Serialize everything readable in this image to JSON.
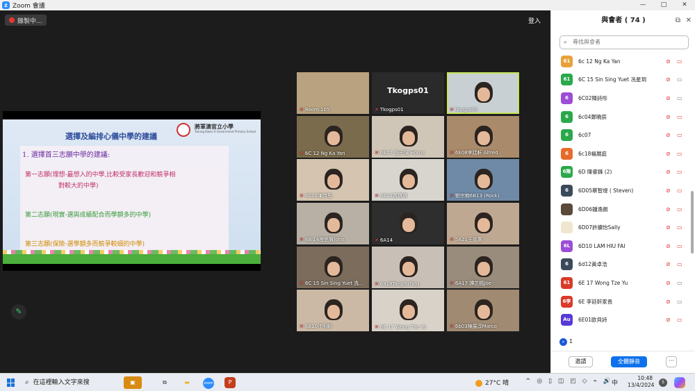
{
  "window": {
    "title": "Zoom 會議",
    "controls": [
      "—",
      "□",
      "✕"
    ]
  },
  "meeting": {
    "recording_label": "錄製中...",
    "exit_label": "登入"
  },
  "slide": {
    "title": "選擇及編排心儀中學的建議",
    "school_name": "將軍澳官立小學",
    "school_name_en": "Tseung Kwan O Government Primary School",
    "heading": "1. 選擇首三志願中學的建議:",
    "choice1_line1": "第一志願(理想-最想入的中學,比較受家長歡迎和競爭相",
    "choice1_line2": "對較大的中學)",
    "choice2": "第二志願(現實-選與成績配合而學額多的中學)",
    "choice3": "第三志願(保險-選學額多而競爭較細的中學)"
  },
  "videos": [
    {
      "label": "Room 105",
      "bg": "#b9a27f"
    },
    {
      "label": "Tkogps01",
      "bg": "#2a2a2a",
      "bigname": "Tkogps01"
    },
    {
      "label": "tkogps09",
      "bg": "#c9d0d3"
    },
    {
      "label": "6C 12 Ng Ka Yan",
      "bg": "#7a6b4c"
    },
    {
      "label": "6B17 洗子誠 Horus",
      "bg": "#cfc6b8"
    },
    {
      "label": "6E08李廷軒 Alfred",
      "bg": "#a98a6a"
    },
    {
      "label": "6C02陳詩彤",
      "bg": "#d4c4b0"
    },
    {
      "label": "6B22黃琪琪",
      "bg": "#d8d5cf"
    },
    {
      "label": "劉宗楠6B13 (Rock)",
      "bg": "#6f8aa6"
    },
    {
      "label": "6B 14陸思賢John",
      "bg": "#b8b0a4"
    },
    {
      "label": "6A14",
      "bg": "#2e2e2e"
    },
    {
      "label": "5A21王盐蕙",
      "bg": "#bfa892"
    },
    {
      "label": "6C 15 Sin Sing Yuet 洗...",
      "bg": "#7c6c5c"
    },
    {
      "label": "6a18TangYuTing",
      "bg": "#c8c0b6"
    },
    {
      "label": "6A17 譚芷楓Joe",
      "bg": "#9a8c7c"
    },
    {
      "label": "6B10江明軒",
      "bg": "#cbb9a6"
    },
    {
      "label": "6E 17 Wong Tze Yu",
      "bg": "#d9d2c8"
    },
    {
      "label": "6b03陳展淳Marco",
      "bg": "#a08a72"
    }
  ],
  "participants_panel": {
    "title": "與會者 ( 74 )",
    "popout_icon": "⧉",
    "close_icon": "✕",
    "search_placeholder": "尋找與會者",
    "raised_hands_label": "1",
    "raised_hands_icon": "»",
    "invite_label": "邀請",
    "mute_all_label": "全體靜音",
    "more_label": "···",
    "items": [
      {
        "avatar": "61",
        "color": "#e8a23a",
        "name": "6c 12 Ng Ka Yan",
        "cam": "off"
      },
      {
        "avatar": "61",
        "color": "#2aa84a",
        "name": "6C 15 Sin Sing Yuet 冼星玥",
        "cam": "on"
      },
      {
        "avatar": "6",
        "color": "#9b4dd6",
        "name": "6C02陳詩彤",
        "cam": "on"
      },
      {
        "avatar": "6",
        "color": "#2aa84a",
        "name": "6c04鄭曉辰",
        "cam": "off"
      },
      {
        "avatar": "6",
        "color": "#2aa84a",
        "name": "6c07",
        "cam": "off"
      },
      {
        "avatar": "6",
        "color": "#e86a2a",
        "name": "6c18楊展庭",
        "cam": "off"
      },
      {
        "avatar": "6陳",
        "color": "#2aa84a",
        "name": "6D 陳睿鋒 (2)",
        "cam": "off"
      },
      {
        "avatar": "6",
        "color": "#3a4a5a",
        "name": "6D05蔡智燈 ( Steven)",
        "cam": "off"
      },
      {
        "avatar": "",
        "color": "#5a4a3a",
        "name": "6D06鍾逸朗",
        "cam": "off"
      },
      {
        "avatar": "",
        "color": "#f0e6d0",
        "name": "6D07許擴怡Sally",
        "cam": "off"
      },
      {
        "avatar": "6L",
        "color": "#9b4dd6",
        "name": "6D10 LAM HIU FAI",
        "cam": "off"
      },
      {
        "avatar": "6",
        "color": "#3a4a5a",
        "name": "6d12黃卓浩",
        "cam": "off"
      },
      {
        "avatar": "61",
        "color": "#d93a2a",
        "name": "6E 17 Wong Tze Yu",
        "cam": "on"
      },
      {
        "avatar": "6李",
        "color": "#d93a2a",
        "name": "6E 李廷軒家長",
        "cam": "on"
      },
      {
        "avatar": "Au",
        "color": "#5a3ad6",
        "name": "6E01歐貝詩",
        "cam": "off"
      }
    ]
  },
  "taskbar": {
    "search_placeholder": "在這裡輸入文字來搜",
    "zoom_label": "zoom",
    "ppt_label": "P",
    "weather_temp": "27°C",
    "weather_desc": "晴",
    "tray_icons": "^ ◎ ▯ ◫ ◰ ◇ ⌁ 🔊",
    "ime": "中",
    "time": "10:48",
    "date": "13/4/2024",
    "notify_count": "5"
  },
  "colors": {
    "accent": "#0e71eb",
    "active_speaker": "#c7e35c",
    "muted": "#d33"
  }
}
